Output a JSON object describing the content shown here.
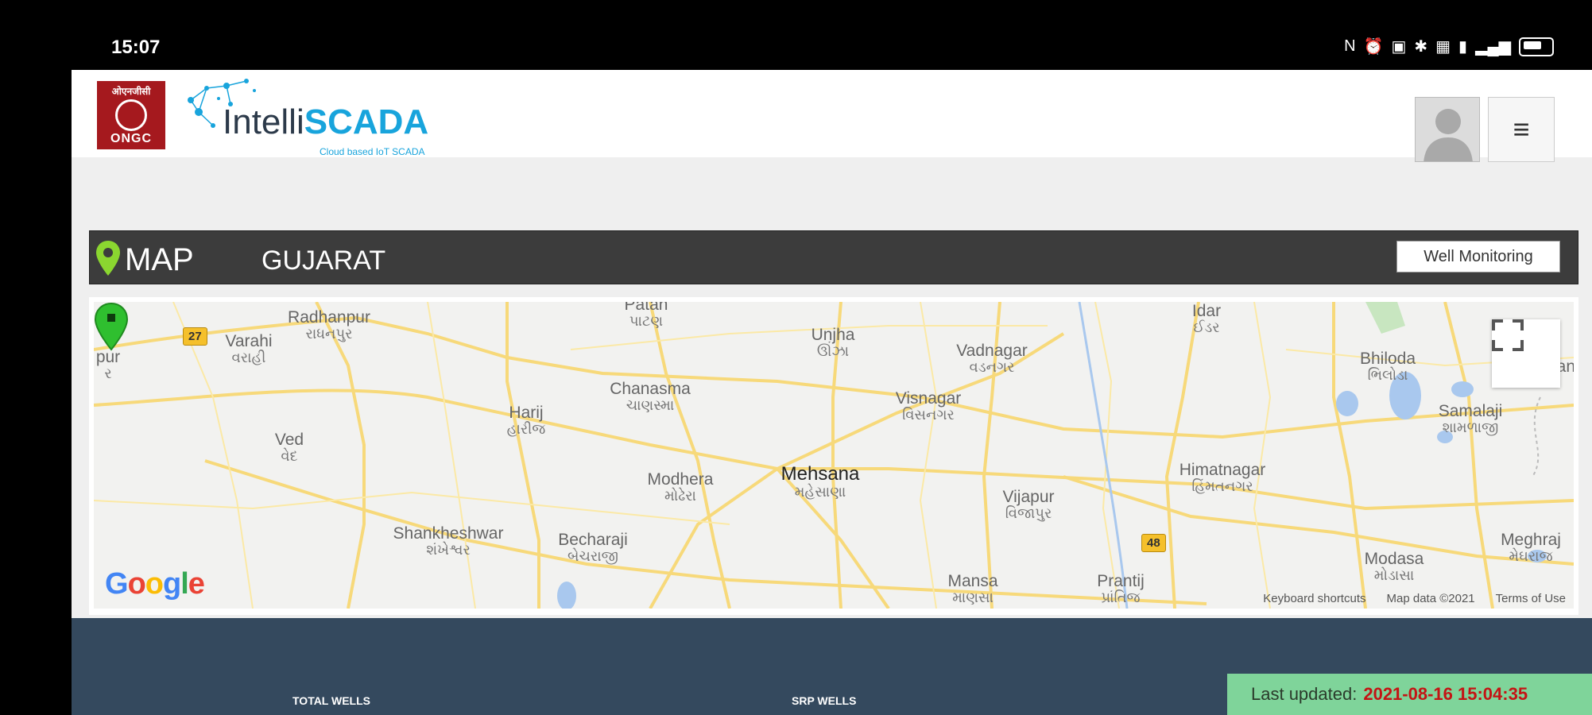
{
  "status_bar": {
    "time": "15:07"
  },
  "header": {
    "ongc_logo": {
      "hindi": "ओएनजीसी",
      "english": "ONGC"
    },
    "brand": {
      "part1": "Intelli",
      "part2": "SCADA",
      "tagline": "Cloud based IoT SCADA"
    },
    "avatar_icon": "user-avatar-placeholder",
    "menu_icon": "hamburger-menu"
  },
  "map_bar": {
    "title": "MAP",
    "region": "GUJARAT",
    "button_label": "Well Monitoring",
    "pin_color": "#8bd630"
  },
  "map": {
    "places": [
      {
        "name": "Varahi",
        "sub": "વરાહી"
      },
      {
        "name": "Radhanpur",
        "sub": "રાધનપુર"
      },
      {
        "name": "Patan",
        "sub": "પાટણ"
      },
      {
        "name": "Unjha",
        "sub": "ઊંઝા"
      },
      {
        "name": "Vadnagar",
        "sub": "વડનગર"
      },
      {
        "name": "Idar",
        "sub": "ઈડર"
      },
      {
        "name": "Bhiloda",
        "sub": "ભિલોડા"
      },
      {
        "name": "Ratan",
        "sub": ""
      },
      {
        "name": "Chanasma",
        "sub": "ચાણસ્મા"
      },
      {
        "name": "Harij",
        "sub": "હારીજ"
      },
      {
        "name": "Visnagar",
        "sub": "વિસનગર"
      },
      {
        "name": "Samalaji",
        "sub": "શામળાજી"
      },
      {
        "name": "Ved",
        "sub": "વેદ"
      },
      {
        "name": "Mehsana",
        "sub": "મહેસાણા"
      },
      {
        "name": "Modhera",
        "sub": "મોઢેરા"
      },
      {
        "name": "Himatnagar",
        "sub": "હિંમતનગર"
      },
      {
        "name": "Vijapur",
        "sub": "વિજાપુર"
      },
      {
        "name": "Shankheshwar",
        "sub": "શંખેશ્વર"
      },
      {
        "name": "Becharaji",
        "sub": "બેચરાજી"
      },
      {
        "name": "Mansa",
        "sub": "માણસા"
      },
      {
        "name": "Prantij",
        "sub": "પ્રાંતિજ"
      },
      {
        "name": "Modasa",
        "sub": "મોડાસા"
      },
      {
        "name": "Meghraj",
        "sub": "મેઘરાજ"
      },
      {
        "name": "pur",
        "sub": "ર"
      }
    ],
    "highways": [
      "27",
      "48"
    ],
    "google_logo": "Google",
    "footer": {
      "shortcuts": "Keyboard shortcuts",
      "data": "Map data ©2021",
      "terms": "Terms of Use"
    },
    "marker_color": "#2fbf2f",
    "fullscreen_icon": "fullscreen-expand"
  },
  "stats": {
    "total_wells_label": "TOTAL WELLS",
    "srp_wells_label": "SRP WELLS",
    "last_updated_label": "Last updated:",
    "last_updated_value": "2021-08-16 15:04:35"
  }
}
